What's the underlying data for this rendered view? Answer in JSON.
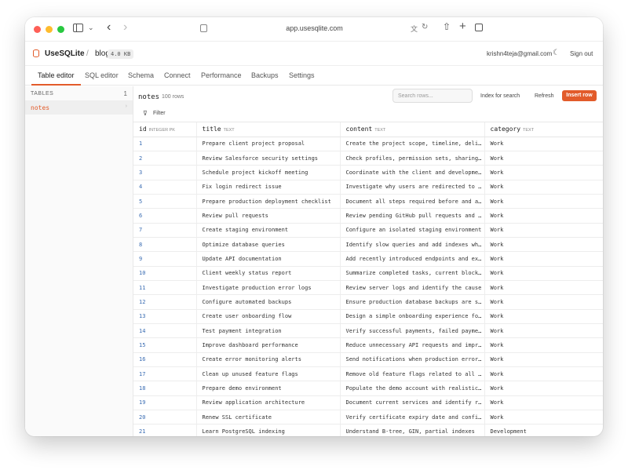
{
  "browser": {
    "address": "app.usesqlite.com"
  },
  "app": {
    "brand": "UseSQLite",
    "separator": "/",
    "db_name": "blog",
    "db_size": "4.0 KB",
    "user_email": "krishn4teja@gmail.com",
    "sign_out": "Sign out"
  },
  "tabs": [
    {
      "label": "Table editor",
      "active": true
    },
    {
      "label": "SQL editor"
    },
    {
      "label": "Schema"
    },
    {
      "label": "Connect"
    },
    {
      "label": "Performance"
    },
    {
      "label": "Backups"
    },
    {
      "label": "Settings"
    }
  ],
  "sidebar": {
    "label": "TABLES",
    "count": "1",
    "items": [
      {
        "label": "notes"
      }
    ]
  },
  "toolbar": {
    "table_name": "notes",
    "row_count": "100 rows",
    "search_placeholder": "Search rows...",
    "index_label": "Index for search",
    "refresh_label": "Refresh",
    "insert_label": "Insert row",
    "filter_label": "Filter"
  },
  "table": {
    "columns": [
      {
        "name": "id",
        "type": "INTEGER PK"
      },
      {
        "name": "title",
        "type": "TEXT"
      },
      {
        "name": "content",
        "type": "TEXT"
      },
      {
        "name": "category",
        "type": "TEXT"
      }
    ],
    "rows": [
      [
        "1",
        "Prepare client project proposal",
        "Create the project scope, timeline, deliverables",
        "Work"
      ],
      [
        "2",
        "Review Salesforce security settings",
        "Check profiles, permission sets, sharing rules",
        "Work"
      ],
      [
        "3",
        "Schedule project kickoff meeting",
        "Coordinate with the client and development team",
        "Work"
      ],
      [
        "4",
        "Fix login redirect issue",
        "Investigate why users are redirected to the wrong page",
        "Work"
      ],
      [
        "5",
        "Prepare production deployment checklist",
        "Document all steps required before and after release",
        "Work"
      ],
      [
        "6",
        "Review pull requests",
        "Review pending GitHub pull requests and comments",
        "Work"
      ],
      [
        "7",
        "Create staging environment",
        "Configure an isolated staging environment",
        "Work"
      ],
      [
        "8",
        "Optimize database queries",
        "Identify slow queries and add indexes where needed",
        "Work"
      ],
      [
        "9",
        "Update API documentation",
        "Add recently introduced endpoints and examples",
        "Work"
      ],
      [
        "10",
        "Client weekly status report",
        "Summarize completed tasks, current blockers",
        "Work"
      ],
      [
        "11",
        "Investigate production error logs",
        "Review server logs and identify the cause",
        "Work"
      ],
      [
        "12",
        "Configure automated backups",
        "Ensure production database backups are scheduled",
        "Work"
      ],
      [
        "13",
        "Create user onboarding flow",
        "Design a simple onboarding experience for new users",
        "Work"
      ],
      [
        "14",
        "Test payment integration",
        "Verify successful payments, failed payments",
        "Work"
      ],
      [
        "15",
        "Improve dashboard performance",
        "Reduce unnecessary API requests and improve loading",
        "Work"
      ],
      [
        "16",
        "Create error monitoring alerts",
        "Send notifications when production errors occur",
        "Work"
      ],
      [
        "17",
        "Clean up unused feature flags",
        "Remove old feature flags related to all releases",
        "Work"
      ],
      [
        "18",
        "Prepare demo environment",
        "Populate the demo account with realistic data",
        "Work"
      ],
      [
        "19",
        "Review application architecture",
        "Document current services and identify risks",
        "Work"
      ],
      [
        "20",
        "Renew SSL certificate",
        "Verify certificate expiry date and configuration",
        "Work"
      ],
      [
        "21",
        "Learn PostgreSQL indexing",
        "Understand B-tree, GIN, partial indexes",
        "Development"
      ]
    ]
  },
  "icons": [
    "sidebar-toggle-icon",
    "back-icon",
    "forward-icon",
    "page-icon",
    "translate-icon",
    "reload-icon",
    "share-icon",
    "new-tab-icon",
    "tabs-icon",
    "database-icon",
    "moon-icon",
    "filter-icon",
    "chevron-right-icon"
  ],
  "colors": {
    "accent": "#e25b2a",
    "id_link": "#3b6db3"
  }
}
